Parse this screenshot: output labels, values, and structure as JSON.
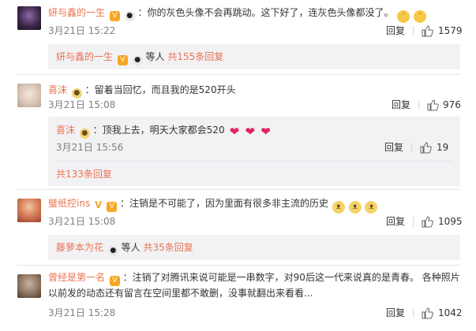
{
  "comments": [
    {
      "user": "妍与鑫的一生",
      "text": "：你的灰色头像不会再跳动。这下好了，连灰色头像都没了。",
      "date": "3月21日 15:22",
      "reply_label": "回复",
      "likes": "1579",
      "emojis": [
        "laugh",
        "laugh"
      ],
      "badges": [
        "vip-icon",
        "panda-icon"
      ],
      "sub_summary": {
        "user": "妍与鑫的一生",
        "suffix": "等人",
        "count_text": "共155条回复",
        "badges": [
          "vip-icon",
          "panda-icon"
        ]
      }
    },
    {
      "user": "喜沫",
      "text": "：留着当回忆，而且我的是520开头",
      "date": "3月21日 15:08",
      "reply_label": "回复",
      "likes": "976",
      "badges": [
        "bear-icon"
      ],
      "sub_reply": {
        "user": "喜沫",
        "text": "：顶我上去，明天大家都会520",
        "emojis": [
          "heart",
          "heart",
          "heart"
        ],
        "date": "3月21日 15:56",
        "reply_label": "回复",
        "likes": "19",
        "badges": [
          "bear-icon"
        ]
      },
      "more_text": "共133条回复"
    },
    {
      "user": "璧纸控ins",
      "text": "：注销是不可能了，因为里面有很多非主流的历史",
      "date": "3月21日 15:08",
      "reply_label": "回复",
      "likes": "1095",
      "emojis": [
        "cat",
        "cat",
        "cat"
      ],
      "badges": [
        "v-icon",
        "vip-icon"
      ],
      "sub_summary": {
        "user": "藤萝本为花",
        "suffix": "等人",
        "count_text": "共35条回复",
        "badges": [
          "panda-icon"
        ]
      }
    },
    {
      "user": "曾经是第一名",
      "text": "：注销了对腾讯来说可能是一串数字，对90后这一代来说真的是青春。 各种照片以前发的动态还有留言在空间里都不敢删，没事就翻出来看看...",
      "date": "3月21日 15:28",
      "reply_label": "回复",
      "likes": "1042",
      "badges": [
        "vip-icon"
      ]
    }
  ],
  "colors": {
    "username": "#eb7350",
    "meta": "#808080",
    "subbox": "#f2f2f5"
  }
}
